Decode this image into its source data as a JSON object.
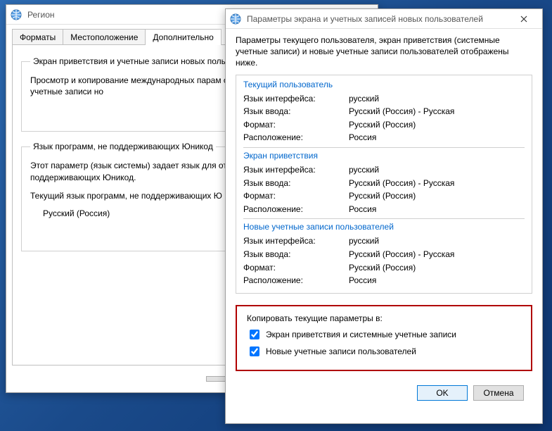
{
  "region_window": {
    "title": "Регион",
    "tabs": {
      "formats": "Форматы",
      "location": "Местоположение",
      "advanced": "Дополнительно"
    },
    "group1": {
      "legend": "Экран приветствия и учетные записи новых польз",
      "desc": "Просмотр и копирование международных парам системные учетные записи и учетные записи но",
      "button_partial": ""
    },
    "group2": {
      "legend": "Язык программ, не поддерживающих Юникод",
      "desc1": "Этот параметр (язык системы) задает язык для от программах, не поддерживающих Юникод.",
      "desc2": "Текущий язык программ, не поддерживающих Ю",
      "current_lang": "Русский (Россия)",
      "button_partial": ""
    },
    "buttons": {
      "ok": "",
      "cancel": "",
      "apply": ""
    }
  },
  "params_window": {
    "title": "Параметры экрана и учетных записей новых пользователей",
    "intro": "Параметры текущего пользователя, экран приветствия (системные учетные записи) и новые учетные записи пользователей отображены ниже.",
    "labels": {
      "ui_lang": "Язык интерфейса:",
      "input_lang": "Язык ввода:",
      "format": "Формат:",
      "location": "Расположение:"
    },
    "sections": {
      "current_user": {
        "title": "Текущий пользователь",
        "ui_lang": "русский",
        "input_lang": "Русский (Россия) - Русская",
        "format": "Русский (Россия)",
        "location": "Россия"
      },
      "welcome": {
        "title": "Экран приветствия",
        "ui_lang": "русский",
        "input_lang": "Русский (Россия) - Русская",
        "format": "Русский (Россия)",
        "location": "Россия"
      },
      "new_users": {
        "title": "Новые учетные записи пользователей",
        "ui_lang": "русский",
        "input_lang": "Русский (Россия) - Русская",
        "format": "Русский (Россия)",
        "location": "Россия"
      }
    },
    "copy_box": {
      "heading": "Копировать текущие параметры в:",
      "opt1": "Экран приветствия и системные учетные записи",
      "opt2": "Новые учетные записи пользователей"
    },
    "buttons": {
      "ok": "OK",
      "cancel": "Отмена"
    }
  }
}
